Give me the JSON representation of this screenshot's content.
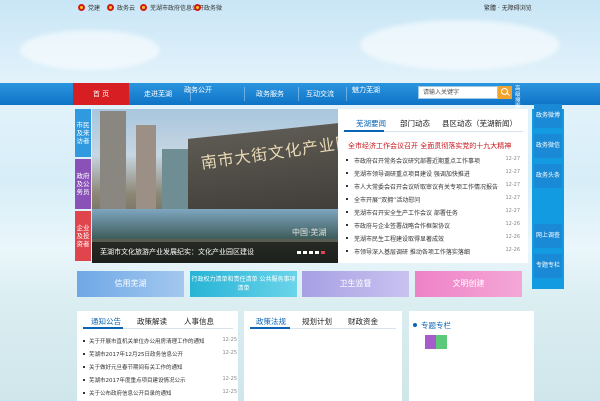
{
  "topbar": {
    "links": [
      "党建",
      "政务云",
      "芜湖市政府信息公开",
      "政务微"
    ],
    "right": "繁體 · 无障碍浏览"
  },
  "nav": {
    "home": "首 页",
    "items": [
      "走进芜湖",
      "政务公开",
      "政务服务",
      "互动交流",
      "魅力芜湖"
    ],
    "search_placeholder": "请输入关键字",
    "advanced": "高级搜索"
  },
  "left_tabs": [
    "市民及来访者",
    "政府及公务员",
    "企业及投资者"
  ],
  "slide": {
    "wall_text": "南市大街文化产业园",
    "seal": "中国·芜湖",
    "caption": "芜湖市文化旅游产业发展纪实：文化产业园区建设"
  },
  "news": {
    "tabs": [
      "芜湖要闻",
      "部门动态",
      "县区动态（芜湖新闻）"
    ],
    "headline": "全市经济工作会议召开 全面贯彻落实党的十九大精神",
    "items": [
      {
        "title": "市政府召开常务会议研究部署近期重点工作事项",
        "date": "12-27"
      },
      {
        "title": "芜湖市领导调研重点项目建设 强调加快推进",
        "date": "12-27"
      },
      {
        "title": "市人大常委会召开会议听取审议有关专项工作情况报告",
        "date": "12-27"
      },
      {
        "title": "全市开展“双拥”活动慰问",
        "date": "12-27"
      },
      {
        "title": "芜湖市召开安全生产工作会议 部署任务",
        "date": "12-27"
      },
      {
        "title": "市政府与企业签署战略合作框架协议",
        "date": "12-26"
      },
      {
        "title": "芜湖市民生工程建设取得显著成效",
        "date": "12-26"
      },
      {
        "title": "市领导深入基层调研 推动各项工作落实落细",
        "date": "12-26"
      }
    ]
  },
  "right_tabs": [
    "政务微博",
    "政务微信",
    "政务头条",
    "网上调查",
    "专题专栏"
  ],
  "banners": [
    "信用芜湖",
    "行政权力清单和责任清单 公共服务事项清单",
    "卫生监督",
    "文明创建"
  ],
  "panel1": {
    "tabs": [
      "通知公告",
      "政策解读",
      "人事信息"
    ],
    "items": [
      {
        "title": "关于开展市直机关单位办公用房清理工作的通知",
        "date": "12-25"
      },
      {
        "title": "芜湖市2017年12月25日政务信息公开",
        "date": "12-25"
      },
      {
        "title": "关于做好元旦春节期间有关工作的通知",
        "date": ""
      },
      {
        "title": "芜湖市2017年度重点项目建设情况公示",
        "date": "12-25"
      },
      {
        "title": "关于公布政府信息公开目录的通知",
        "date": "12-25"
      }
    ]
  },
  "panel2": {
    "tabs": [
      "政策法规",
      "规划计划",
      "财政资金"
    ]
  },
  "focus": {
    "title": "专题专栏"
  },
  "colors": {
    "nav": "#1a86d6",
    "home": "#d71e22",
    "headline": "#c8141a"
  }
}
